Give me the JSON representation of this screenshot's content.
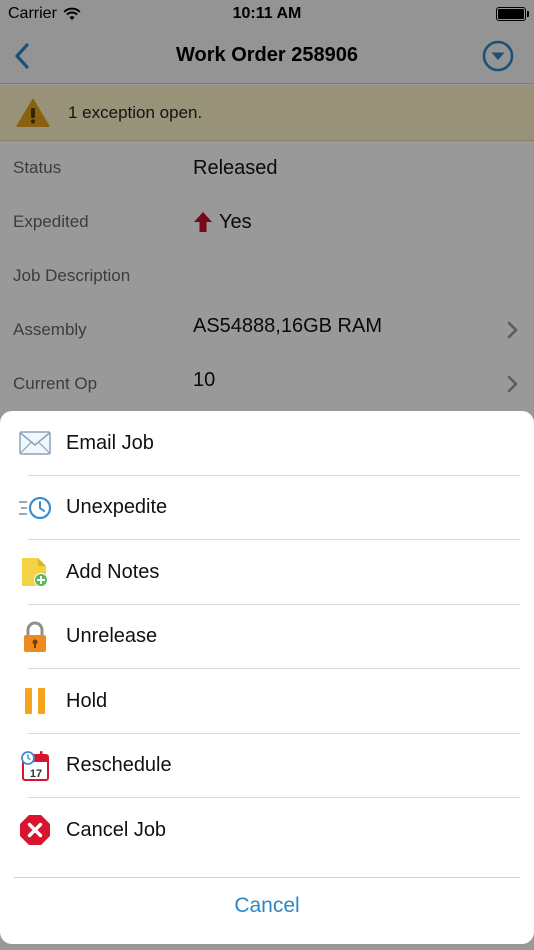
{
  "status_bar": {
    "carrier": "Carrier",
    "time": "10:11 AM"
  },
  "nav": {
    "title": "Work Order 258906",
    "back_icon": "chevron-left-icon",
    "menu_icon": "circle-chevron-down-icon"
  },
  "banner": {
    "text": "1 exception open.",
    "icon": "warning-icon"
  },
  "details": [
    {
      "label": "Status",
      "value": "Released",
      "chevron": false
    },
    {
      "label": "Expedited",
      "value": "Yes",
      "icon": "arrow-up-icon",
      "chevron": false
    },
    {
      "label": "Job Description",
      "value": "",
      "chevron": false
    },
    {
      "label": "Assembly",
      "value": "AS54888,16GB RAM",
      "chevron": true
    },
    {
      "label": "Current Op",
      "value": "10",
      "chevron": true
    }
  ],
  "actions": [
    {
      "label": "Email Job",
      "icon": "envelope-icon"
    },
    {
      "label": "Unexpedite",
      "icon": "clock-icon"
    },
    {
      "label": "Add Notes",
      "icon": "note-add-icon"
    },
    {
      "label": "Unrelease",
      "icon": "lock-icon"
    },
    {
      "label": "Hold",
      "icon": "pause-icon"
    },
    {
      "label": "Reschedule",
      "icon": "calendar-icon",
      "calendar_day": "17"
    },
    {
      "label": "Cancel Job",
      "icon": "cancel-x-icon"
    }
  ],
  "cancel_label": "Cancel",
  "colors": {
    "accent": "#2f87c6",
    "banner_bg": "#fdf3c9",
    "warning": "#e5a21b",
    "expedite_arrow": "#c8102e",
    "cancel_red": "#d7152f"
  }
}
